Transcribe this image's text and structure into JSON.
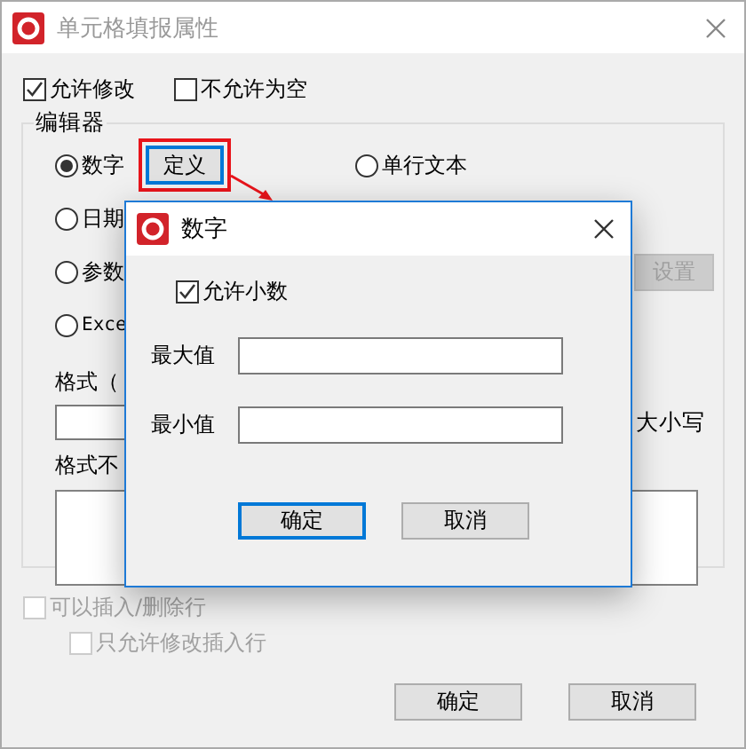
{
  "window": {
    "title": "单元格填报属性"
  },
  "options": [
    {
      "label": "允许修改",
      "checked": true
    },
    {
      "label": "不允许为空",
      "checked": false
    }
  ],
  "editor": {
    "label": "编辑器",
    "types": [
      {
        "label": "数字",
        "selected": true
      },
      {
        "label": "日期",
        "selected": false
      },
      {
        "label": "参数",
        "selected": false
      },
      {
        "label": "Exce",
        "selected": false
      },
      {
        "label": "单行文本",
        "selected": false
      }
    ],
    "define_button": "定义",
    "settings_button": {
      "label": "设置",
      "disabled": true
    },
    "format_label": "格式（",
    "case_label": "大小写",
    "format_hint_label": "格式不"
  },
  "row_options": [
    {
      "label": "可以插入/删除行",
      "checked": false,
      "disabled": true
    },
    {
      "label": "只允许修改插入行",
      "checked": false,
      "disabled": true
    }
  ],
  "buttons": [
    "确定",
    "取消"
  ],
  "number_dialog": {
    "title": "数字",
    "allow_decimal": {
      "label": "允许小数",
      "checked": true
    },
    "fields": [
      {
        "label": "最大值"
      },
      {
        "label": "最小值"
      }
    ],
    "buttons": [
      {
        "label": "确定",
        "focused": true
      },
      {
        "label": "取消",
        "focused": false
      }
    ]
  }
}
